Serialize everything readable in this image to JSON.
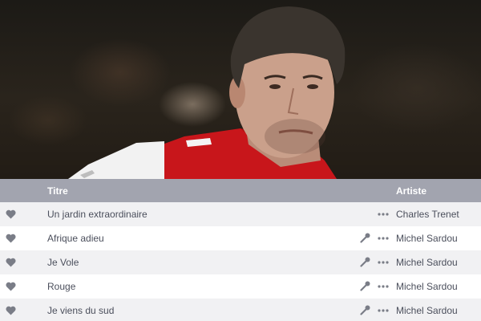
{
  "table": {
    "headers": {
      "title": "Titre",
      "artist": "Artiste"
    },
    "rows": [
      {
        "title": "Un jardin extraordinaire",
        "artist": "Charles Trenet",
        "has_lyrics": false
      },
      {
        "title": "Afrique adieu",
        "artist": "Michel Sardou",
        "has_lyrics": true
      },
      {
        "title": "Je Vole",
        "artist": "Michel Sardou",
        "has_lyrics": true
      },
      {
        "title": "Rouge",
        "artist": "Michel Sardou",
        "has_lyrics": true
      },
      {
        "title": "Je viens du sud",
        "artist": "Michel Sardou",
        "has_lyrics": true
      }
    ]
  },
  "colors": {
    "header_bg": "#a2a4af",
    "row_alt_bg": "#f1f1f3",
    "icon": "#7a7d87",
    "text": "#4b4f5c"
  },
  "icons": {
    "favorite": "heart-icon",
    "lyrics": "microphone-icon",
    "more": "more-dots-icon"
  }
}
